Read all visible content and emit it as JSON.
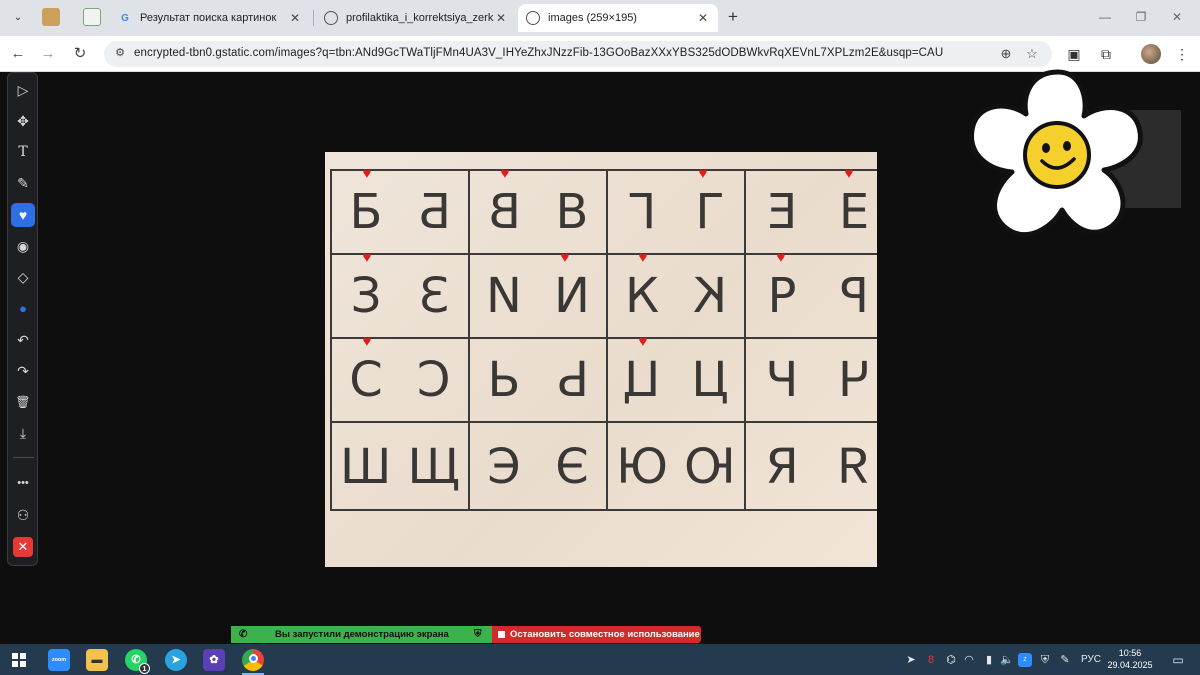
{
  "browser": {
    "tabs": [
      {
        "title": "Результат поиска картинок",
        "favicon": "google-icon"
      },
      {
        "title": "profilaktika_i_korrektsiya_zerkal",
        "favicon": "globe-icon"
      },
      {
        "title": "images (259×195)",
        "favicon": "globe-icon",
        "active": true
      }
    ],
    "new_tab_label": "+",
    "url": "encrypted-tbn0.gstatic.com/images?q=tbn:ANd9GcTWaTljFMn4UA3V_IHYeZhxJNzzFib-13GOoBazXXxYBS325dODBWkvRqXEVnL7XPLzm2E&usqp=CAU"
  },
  "annotation_tools": [
    {
      "name": "select-tool",
      "glyph": "▷"
    },
    {
      "name": "move-tool",
      "glyph": "✥"
    },
    {
      "name": "text-tool",
      "glyph": "T"
    },
    {
      "name": "pen-tool",
      "glyph": "✎"
    },
    {
      "name": "stamp-tool",
      "glyph": "♥"
    },
    {
      "name": "spotlight-tool",
      "glyph": "◉"
    },
    {
      "name": "eraser-tool",
      "glyph": "◇"
    },
    {
      "name": "color-tool",
      "glyph": "●"
    },
    {
      "name": "undo-tool",
      "glyph": "↶"
    },
    {
      "name": "redo-tool",
      "glyph": "↷"
    },
    {
      "name": "clear-tool",
      "glyph": "🗑"
    },
    {
      "name": "save-tool",
      "glyph": "⤓"
    },
    {
      "name": "more-tool",
      "glyph": "•••"
    },
    {
      "name": "participants-tool",
      "glyph": "⚇"
    },
    {
      "name": "close-tool",
      "glyph": "✕"
    }
  ],
  "letter_grid": [
    [
      [
        "Б",
        "Б"
      ],
      [
        "В",
        "В"
      ],
      [
        "Г",
        "Г"
      ],
      [
        "Е",
        "Е"
      ]
    ],
    [
      [
        "З",
        "З"
      ],
      [
        "И",
        "И"
      ],
      [
        "К",
        "К"
      ],
      [
        "Р",
        "Р"
      ]
    ],
    [
      [
        "С",
        "С"
      ],
      [
        "Ь",
        "Ь"
      ],
      [
        "Ц",
        "Ц"
      ],
      [
        "Ч",
        "Ч"
      ]
    ],
    [
      [
        "Ш",
        "Щ"
      ],
      [
        "Э",
        "Є"
      ],
      [
        "Ю",
        "Ю"
      ],
      [
        "Я",
        "Я"
      ]
    ]
  ],
  "share": {
    "started": "Вы запустили демонстрацию экрана",
    "stop": "Остановить совместное использование"
  },
  "taskbar": {
    "apps": [
      "zoom",
      "file-explorer",
      "whatsapp",
      "telegram",
      "app",
      "chrome"
    ],
    "whatsapp_badge": "1",
    "zoom_label": "zoom",
    "lang": "РУС",
    "time": "10:56",
    "date": "29.04.2025"
  },
  "colors": {
    "heart": "#e21b1b",
    "share_ok": "#3bb24a",
    "share_stop": "#d42a2a",
    "annot_select": "#2f6fe6"
  }
}
